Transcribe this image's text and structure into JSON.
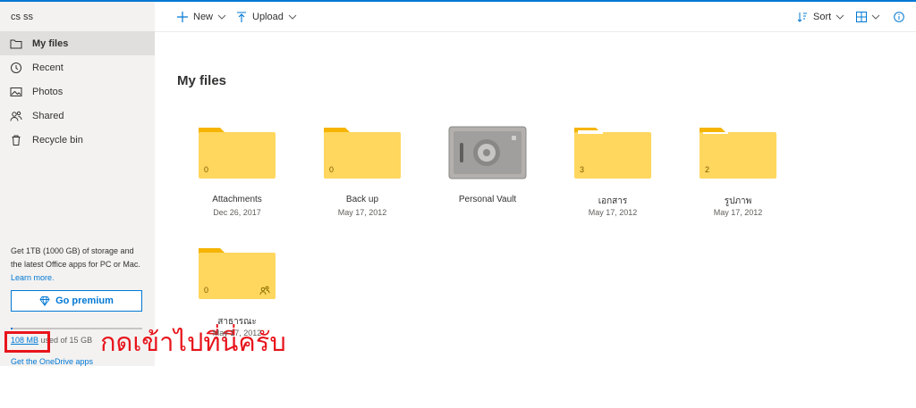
{
  "user": {
    "name": "cs ss"
  },
  "nav": [
    {
      "label": "My files",
      "icon": "folder-icon",
      "active": true
    },
    {
      "label": "Recent",
      "icon": "clock-icon"
    },
    {
      "label": "Photos",
      "icon": "photo-icon"
    },
    {
      "label": "Shared",
      "icon": "people-icon"
    },
    {
      "label": "Recycle bin",
      "icon": "trash-icon"
    }
  ],
  "promo": {
    "line1": "Get 1TB (1000 GB) of storage and",
    "line2": "the latest Office apps for PC or Mac.",
    "learn_more": "Learn more.",
    "button": "Go premium"
  },
  "storage": {
    "used": "108 MB",
    "rest": " used of 15 GB",
    "used_fraction": 0.007
  },
  "get_apps": "Get the OneDrive apps",
  "annotation": "กดเข้าไปที่นี่ครับ",
  "toolbar": {
    "new_label": "New",
    "upload_label": "Upload",
    "sort_label": "Sort"
  },
  "page_title": "My files",
  "items": [
    {
      "name": "Attachments",
      "date": "Dec 26, 2017",
      "count": "0",
      "type": "folder"
    },
    {
      "name": "Back up",
      "date": "May 17, 2012",
      "count": "0",
      "type": "folder"
    },
    {
      "name": "Personal Vault",
      "date": "",
      "count": "",
      "type": "vault"
    },
    {
      "name": "เอกสาร",
      "date": "May 17, 2012",
      "count": "3",
      "type": "folder"
    },
    {
      "name": "รูปภาพ",
      "date": "May 17, 2012",
      "count": "2",
      "type": "folder"
    },
    {
      "name": "สาธารณะ",
      "date": "May 17, 2012",
      "count": "0",
      "type": "shared-folder"
    }
  ],
  "colors": {
    "accent": "#0078d4",
    "folder": "#ffd75e",
    "folder_tab": "#f5b400",
    "annotation": "#e8141b"
  }
}
